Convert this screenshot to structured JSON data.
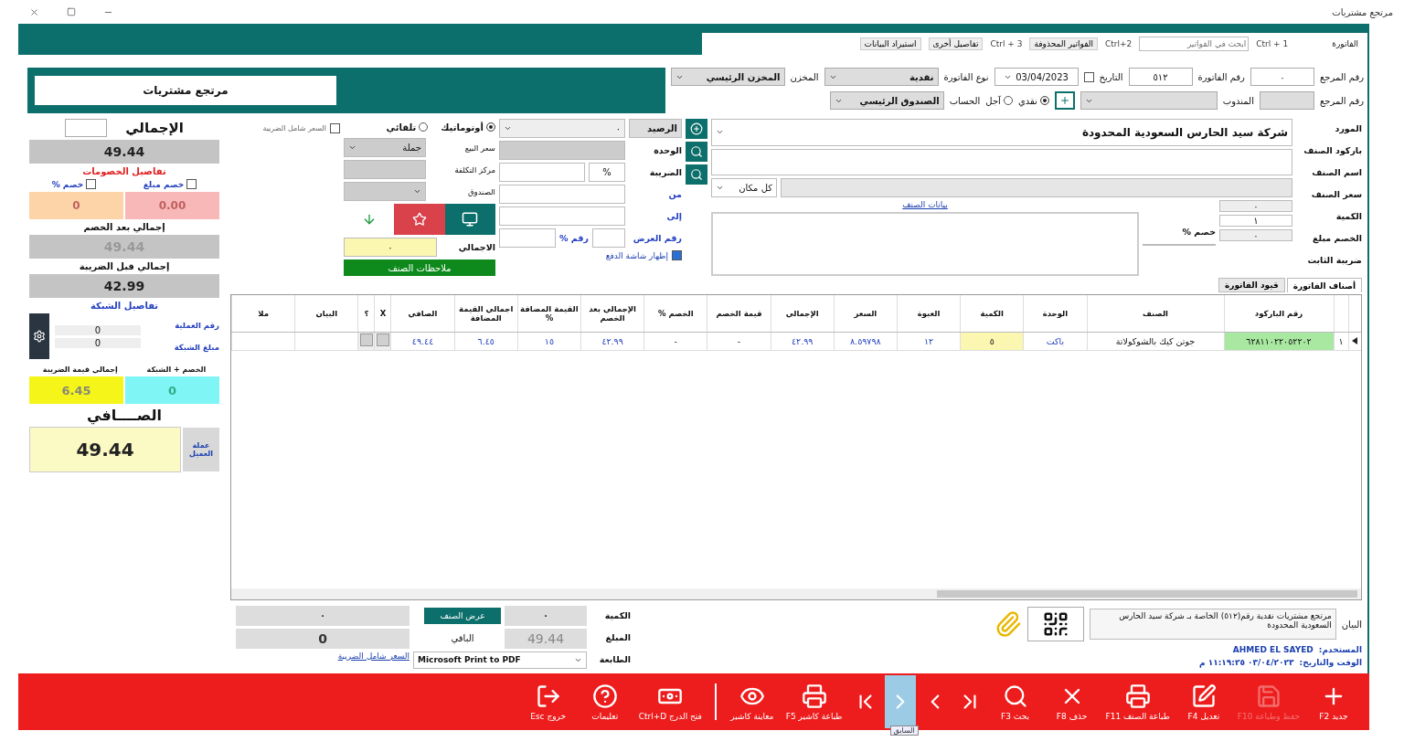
{
  "window": {
    "title": "مرتجع مشتريات"
  },
  "shortcuts": [
    {
      "kind": "tab",
      "label": "الفاتورة"
    },
    {
      "kind": "key",
      "label": "Ctrl + 1"
    },
    {
      "kind": "search",
      "placeholder": "ابحث في الفواتير"
    },
    {
      "kind": "key",
      "label": "Ctrl+2"
    },
    {
      "kind": "button",
      "label": "الفواتير المحذوفة"
    },
    {
      "kind": "key",
      "label": "Ctrl + 3"
    },
    {
      "kind": "button",
      "label": "تفاصيل أخرى"
    },
    {
      "kind": "button",
      "label": "استيراد البيانات"
    }
  ],
  "banner": {
    "title": "مرتجع مشتريات"
  },
  "header": {
    "first_line": [
      {
        "kind": "input",
        "label": "رقم المرجع",
        "value": "٠"
      },
      {
        "kind": "input",
        "label": "رقم الفاتورة",
        "value": "٥١٢"
      },
      {
        "kind": "date",
        "label": "التاريخ",
        "value": "03/04/2023",
        "checked": false
      },
      {
        "kind": "select",
        "label": "نوع الفاتورة",
        "value": "نقدية"
      },
      {
        "kind": "select",
        "label": "المخزن",
        "value": "المخزن الرئيسي"
      }
    ],
    "second_line": [
      {
        "kind": "input",
        "label": "رقم المرجع"
      },
      {
        "kind": "select",
        "label": "المندوب"
      },
      {
        "kind": "add"
      },
      {
        "kind": "radio",
        "options": [
          {
            "label": "نقدي",
            "selected": true
          },
          {
            "label": "آجل",
            "selected": false
          }
        ]
      },
      {
        "kind": "select",
        "label": "الحساب",
        "value": "الصندوق الرئيسي"
      }
    ]
  },
  "entry": {
    "supplier_label": "المورد",
    "supplier": "شركة سيد الحارس السعودية المحدودة",
    "barcode_label": "باركود الصنف",
    "name_label": "اسم الصنف",
    "location": "كل مكان",
    "price_label": "سعر الصنف",
    "price": "٠",
    "qty_label": "الكمية",
    "qty": "١",
    "discount_pct_label": "خصم %",
    "discount_label": "الخصم مبلغ",
    "discount": "٠",
    "tax_label": "ضريبة الثابت",
    "notes_link": "بيانات الصنف",
    "balance_label": "الرصيد",
    "balance": "٠",
    "unit_label": "الوحدة",
    "tax2_label": "الضريبة",
    "tax_pct": "%",
    "from_label": "من",
    "to_label": "إلى",
    "offer_label": "رقم العرض",
    "offer_pct_label": "رقم %",
    "modes": [
      {
        "label": "أوتوماتيك",
        "selected": true
      },
      {
        "label": "تلقائي",
        "selected": false
      }
    ],
    "sale_price_label": "سعر البيع",
    "sale_price": "جملة",
    "cost_center_label": "مركز التكلفة",
    "fund_label": "الصندوق",
    "total_label": "الاجمالي",
    "total": "٠",
    "notes_button": "ملاحظات الصنف",
    "show_payment": {
      "label": "إظهار شاشة الدفع",
      "checked": true
    },
    "tax_inclusive": {
      "label": "السعر شامل الضريبة",
      "checked": false
    }
  },
  "tabs": [
    {
      "label": "أصناف الفاتورة",
      "selected": true
    },
    {
      "label": "قيود الفاتورة",
      "selected": false
    }
  ],
  "table": {
    "columns": [
      {
        "kind": "index"
      },
      {
        "label": "رقم الباركود",
        "kind": "barcode"
      },
      {
        "label": "الصنف",
        "kind": "text"
      },
      {
        "label": "الوحدة",
        "kind": "link"
      },
      {
        "label": "الكمية",
        "kind": "qty"
      },
      {
        "label": "العبوة",
        "kind": "num"
      },
      {
        "label": "السعر",
        "kind": "num"
      },
      {
        "label": "الإجمالي",
        "kind": "num"
      },
      {
        "label": "قيمة الخصم",
        "kind": "text"
      },
      {
        "label": "الخصم %",
        "kind": "text"
      },
      {
        "label": "الإجمالي بعد الخصم",
        "kind": "num"
      },
      {
        "label": "القيمة المضافة %",
        "kind": "num"
      },
      {
        "label": "اجمالي القيمة المضافة",
        "kind": "num"
      },
      {
        "label": "الصافي",
        "kind": "num"
      },
      {
        "label": "X",
        "kind": "action"
      },
      {
        "label": "؟",
        "kind": "action"
      },
      {
        "label": "البيان",
        "kind": "text"
      },
      {
        "label": "ملا",
        "kind": "text"
      }
    ],
    "rows": [
      {
        "cells": [
          "١",
          "٦٢٨١١٠٢٢٠٥٢٢٠٢",
          "جوتن كيك بالشوكولاتة",
          "باكت",
          "٥",
          "١٢",
          "٨.٥٩٧٩٨",
          "٤٢.٩٩",
          "-",
          "-",
          "٤٢.٩٩",
          "١٥",
          "٦.٤٥",
          "٤٩.٤٤"
        ]
      }
    ]
  },
  "payment": {
    "quantity_label": "الكمية",
    "quantity": "٠",
    "show_button": "عرض الصنف",
    "quantity2": "٠",
    "amount_label": "المبلغ",
    "amount": "49.44",
    "remaining_label": "الباقي",
    "remaining": "0",
    "printer_label": "الطابعة",
    "printer": "Microsoft Print to PDF",
    "tax_link": "السعر شامل الضريبة"
  },
  "notes": {
    "label": "البيان",
    "text": "مرتجع مشتريات نقدية رقم(٥١٢) الخاصة بـ شركة سيد الحارس السعودية المحدودة",
    "user_label": "المستخدم:",
    "user": "AHMED EL SAYED",
    "time_label": "الوقت والتاريخ:",
    "time": "٠٣/٠٤/٢٠٢٣ ١١:١٩:٢٥ م"
  },
  "summary": {
    "total_label": "الإجمالي",
    "total": "49.44",
    "discount_title": "تفاصيل الخصومات",
    "discounts": [
      {
        "label": "خصم مبلغ",
        "checked": false,
        "value": "0.00"
      },
      {
        "label": "خصم %",
        "checked": false,
        "value": "0"
      }
    ],
    "after_discount_label": "إجمالي بعد الخصم",
    "after_discount": "49.44",
    "before_tax_label": "إجمالي قبل الضريبة",
    "before_tax": "42.99",
    "network_title": "تفاصيل الشبكة",
    "network": [
      {
        "label": "رقم العملية",
        "value": "0"
      },
      {
        "label": "مبلغ الشبكة",
        "value": "0"
      }
    ],
    "discount_network_label": "الخصم + الشبكة",
    "tax_total_label": "إجمالي قيمة الضريبة",
    "discount_network": "0",
    "tax_total": "6.45",
    "net_label": "الصــــافي",
    "net": "49.44",
    "currency_button": "عملة العميل"
  },
  "toolbar": [
    {
      "kind": "button",
      "label": "جديد F2",
      "disabled": false,
      "hovered": false
    },
    {
      "kind": "button",
      "label": "حفظ وطباعة F10",
      "disabled": true,
      "hovered": false
    },
    {
      "kind": "button",
      "label": "تعديل F4",
      "disabled": false,
      "hovered": false
    },
    {
      "kind": "button",
      "label": "طباعة الصنف F11",
      "disabled": false,
      "hovered": false
    },
    {
      "kind": "button",
      "label": "حذف F8",
      "disabled": false,
      "hovered": false
    },
    {
      "kind": "button",
      "label": "بحث F3",
      "disabled": false,
      "hovered": false
    },
    {
      "kind": "nav",
      "disabled": false,
      "hovered": false
    },
    {
      "kind": "nav",
      "disabled": false,
      "hovered": false
    },
    {
      "kind": "nav",
      "disabled": false,
      "hovered": true,
      "tooltip": "السابق"
    },
    {
      "kind": "nav",
      "disabled": false,
      "hovered": false
    },
    {
      "kind": "button",
      "label": "طباعة كاشير F5",
      "disabled": false,
      "hovered": false
    },
    {
      "kind": "button",
      "label": "معاينة كاشير",
      "disabled": false,
      "hovered": false
    },
    {
      "kind": "separator"
    },
    {
      "kind": "button",
      "label": "فتح الدرج Ctrl+D",
      "disabled": false,
      "hovered": false
    },
    {
      "kind": "button",
      "label": "تعليمات",
      "disabled": false,
      "hovered": false
    },
    {
      "kind": "button",
      "label": "خروج Esc",
      "disabled": false,
      "hovered": false
    }
  ]
}
